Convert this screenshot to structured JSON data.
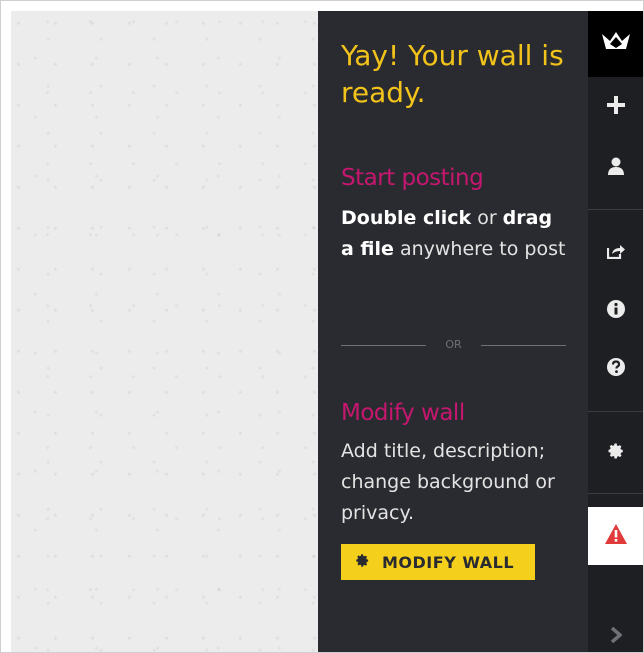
{
  "panel": {
    "title": "Yay! Your wall is ready.",
    "start_heading": "Start posting",
    "start_bold1": "Double click",
    "start_text1": " or ",
    "start_bold2": "drag a file",
    "start_text2": " anywhere to post",
    "divider_text": "OR",
    "modify_heading": "Modify wall",
    "modify_text": "Add title, description; change background or privacy.",
    "modify_button": "MODIFY WALL"
  },
  "rail": {
    "icons": [
      "padlet-logo-icon",
      "plus-icon",
      "user-icon",
      "share-icon",
      "info-icon",
      "help-icon",
      "gear-icon",
      "alert-icon",
      "chevron-right-icon"
    ]
  },
  "colors": {
    "panel_bg": "#2a2b30",
    "title": "#f2c31b",
    "heading": "#c5176f",
    "button": "#f4d01d",
    "alert": "#e03a3a"
  }
}
